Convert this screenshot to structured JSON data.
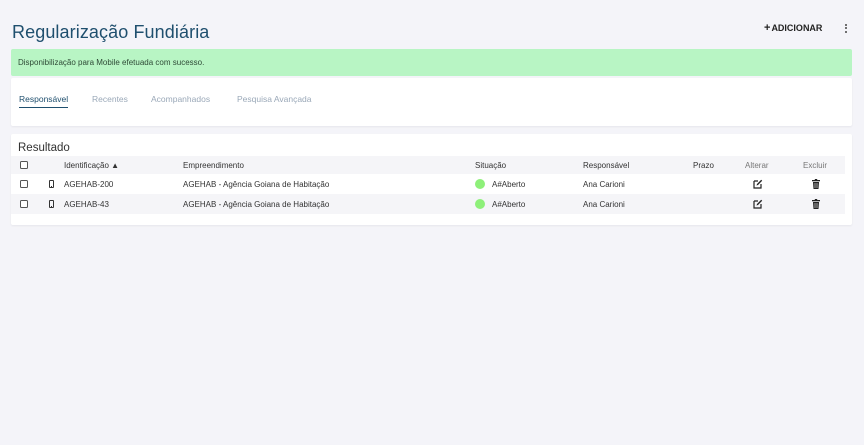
{
  "header": {
    "title": "Regularização Fundiária",
    "add_label": "ADICIONAR"
  },
  "alert": {
    "message": "Disponibilização para Mobile efetuada com sucesso.",
    "color": "#b8f5c4"
  },
  "tabs": [
    {
      "label": "Responsável",
      "active": true
    },
    {
      "label": "Recentes"
    },
    {
      "label": "Acompanhados"
    },
    {
      "label": "Pesquisa Avançada"
    }
  ],
  "results": {
    "title": "Resultado",
    "columns": {
      "identificacao": "Identificação ▲",
      "empreendimento": "Empreendimento",
      "situacao": "Situação",
      "responsavel": "Responsável",
      "prazo": "Prazo",
      "alterar": "Alterar",
      "excluir": "Excluir"
    },
    "rows": [
      {
        "identificacao": "AGEHAB-200",
        "empreendimento": "AGEHAB - Agência Goiana de Habitação",
        "situacao": "A#Aberto",
        "responsavel": "Ana Carioni",
        "prazo": ""
      },
      {
        "identificacao": "AGEHAB-43",
        "empreendimento": "AGEHAB - Agência Goiana de Habitação",
        "situacao": "A#Aberto",
        "responsavel": "Ana Carioni",
        "prazo": ""
      }
    ],
    "status_color": "#8ef07a",
    "icons": {
      "device": "mobile-phone-icon",
      "edit": "edit-icon",
      "delete": "trash-icon"
    }
  },
  "colors": {
    "title": "#1f4f6e",
    "background": "#f4f4f9"
  }
}
